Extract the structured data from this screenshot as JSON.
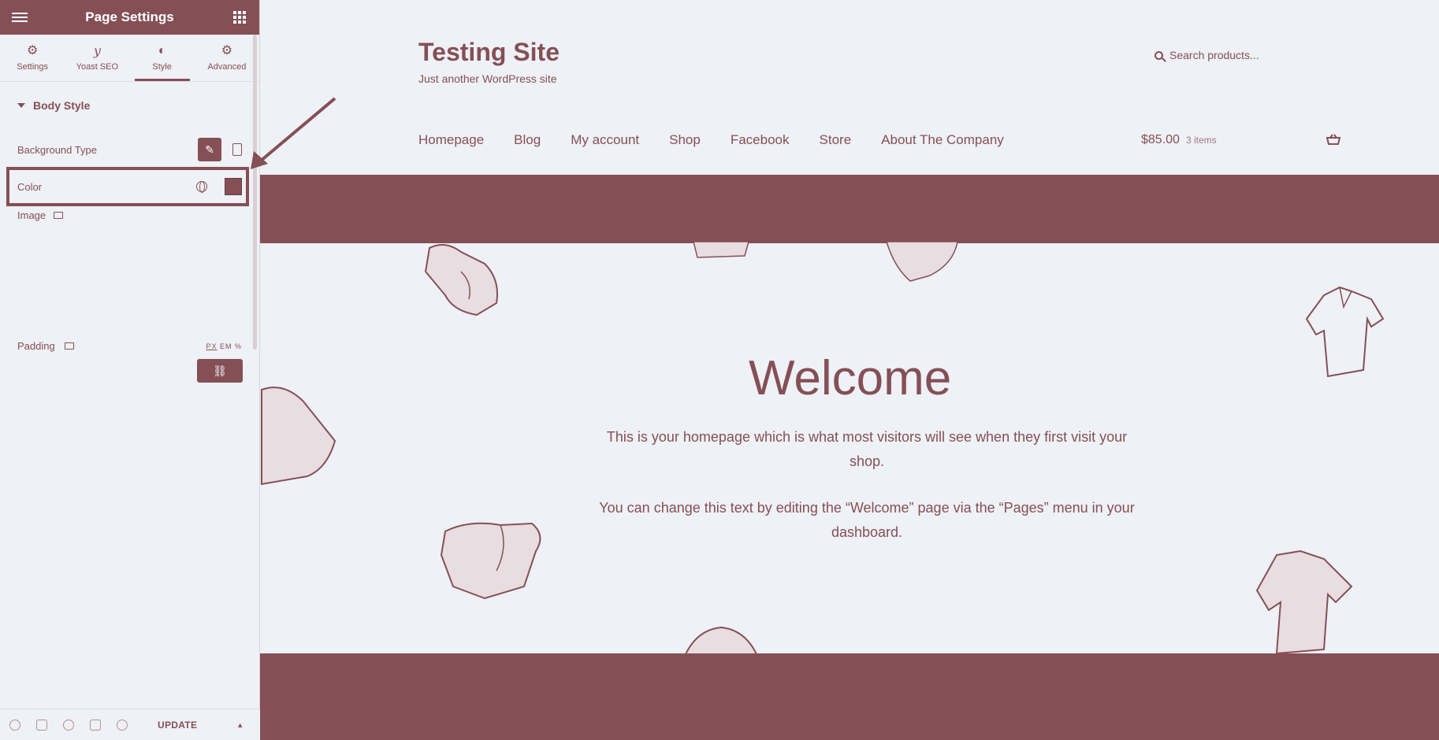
{
  "panel": {
    "title": "Page Settings",
    "tabs": [
      {
        "label": "Settings",
        "icon": "gear-icon"
      },
      {
        "label": "Yoast SEO",
        "icon": "yoast-icon"
      },
      {
        "label": "Style",
        "icon": "contrast-icon"
      },
      {
        "label": "Advanced",
        "icon": "gear-icon"
      }
    ],
    "active_tab": "Style",
    "section_title": "Body Style",
    "controls": {
      "background_type": "Background Type",
      "color": "Color",
      "image": "Image",
      "padding": "Padding",
      "units": {
        "px": "PX",
        "rest": "EM %"
      }
    },
    "footer": {
      "update_label": "UPDATE"
    }
  },
  "site": {
    "title": "Testing Site",
    "tagline": "Just another WordPress site",
    "search_placeholder": "Search products...",
    "nav": [
      "Homepage",
      "Blog",
      "My account",
      "Shop",
      "Facebook",
      "Store",
      "About The Company"
    ],
    "cart": {
      "amount": "$85.00",
      "count": "3 items"
    },
    "welcome": {
      "heading": "Welcome",
      "p1": "This is your homepage which is what most visitors will see when they first visit your shop.",
      "p2": "You can change this text by editing the “Welcome” page via the “Pages” menu in your dashboard."
    }
  },
  "colors": {
    "accent": "#854f56",
    "background": "#eef1f5"
  }
}
